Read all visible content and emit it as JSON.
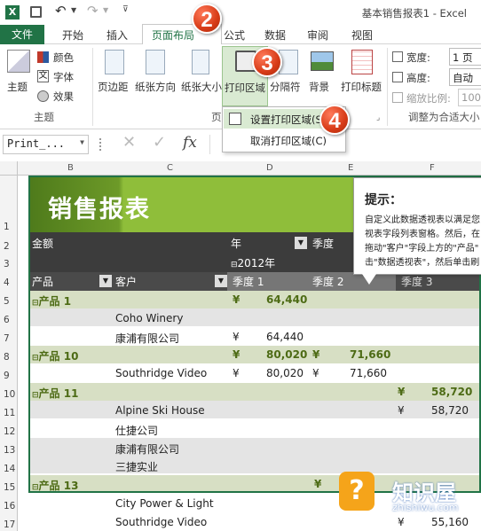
{
  "window": {
    "title": "基本销售报表1 - Excel"
  },
  "tabs": [
    "文件",
    "开始",
    "插入",
    "页面布局",
    "公式",
    "数据",
    "审阅",
    "视图"
  ],
  "ribbon": {
    "themes": {
      "theme": "主题",
      "colors": "颜色",
      "fonts": "字体",
      "effects": "效果",
      "group": "主题"
    },
    "page_setup": {
      "margins": "页边距",
      "orientation": "纸张方向",
      "size": "纸张大小",
      "print_area": "打印区域",
      "breaks": "分隔符",
      "background": "背景",
      "print_titles": "打印标题",
      "group": "页"
    },
    "scale": {
      "width_label": "宽度:",
      "width_value": "1 页",
      "height_label": "高度:",
      "height_value": "自动",
      "scale_label": "缩放比例:",
      "scale_value": "100%",
      "group": "调整为合适大小"
    }
  },
  "print_area_menu": {
    "set": "设置打印区域(S)",
    "clear": "取消打印区域(C)"
  },
  "formula_bar": {
    "name_box": "Print_...",
    "fx": "fx"
  },
  "columns": [
    "B",
    "C",
    "D",
    "E",
    "F"
  ],
  "rows": [
    "1",
    "2",
    "3",
    "4",
    "5",
    "6",
    "7",
    "8",
    "9",
    "10",
    "11",
    "12",
    "13",
    "14",
    "15",
    "16",
    "17"
  ],
  "report": {
    "title": "销售报表",
    "amount": "金额",
    "year": "年",
    "quarter": "季度",
    "year_value": "2012年",
    "year_prefix": "⊟",
    "product": "产品",
    "customer": "客户",
    "q1": "季度 1",
    "q2": "季度 2",
    "q_more": "季度 3"
  },
  "grid": {
    "yen": "¥",
    "p1": "产品 1",
    "p1_total": "64,440",
    "coho": "Coho Winery",
    "kangpu": "康浦有限公司",
    "kangpu_v": "64,440",
    "p10": "产品 10",
    "p10_q1": "80,020",
    "p10_q2": "71,660",
    "southridge": "Southridge Video",
    "sr_q1": "80,020",
    "sr_q2": "71,660",
    "p11": "产品 11",
    "p11_v": "58,720",
    "alpine": "Alpine Ski House",
    "alpine_v": "58,720",
    "shijie": "仕捷公司",
    "kangpu2": "康浦有限公司",
    "sanjie": "三捷实业",
    "p13": "产品 13",
    "citypower": "City Power & Light",
    "southridge2": "Southridge Video",
    "sr2_v": "55,160"
  },
  "tooltip": {
    "title": "提示：",
    "lines": [
      "自定义此数据透视表以满足您",
      "视表字段列表窗格。然后，在",
      "拖动\"客户\"字段上方的\"产品\"",
      "击\"数据透视表\"，然后单击刷"
    ]
  },
  "badges": [
    "2",
    "3",
    "4"
  ],
  "watermark": {
    "name": "知识屋",
    "url": "zhishiwu.com",
    "glyph": "?"
  },
  "colors": {
    "excel_green": "#217346",
    "title_green_dark": "#4e7a1b",
    "title_green_light": "#8fbe3a",
    "header_dark": "#3c3c3c",
    "band": "#d7dfc4"
  }
}
